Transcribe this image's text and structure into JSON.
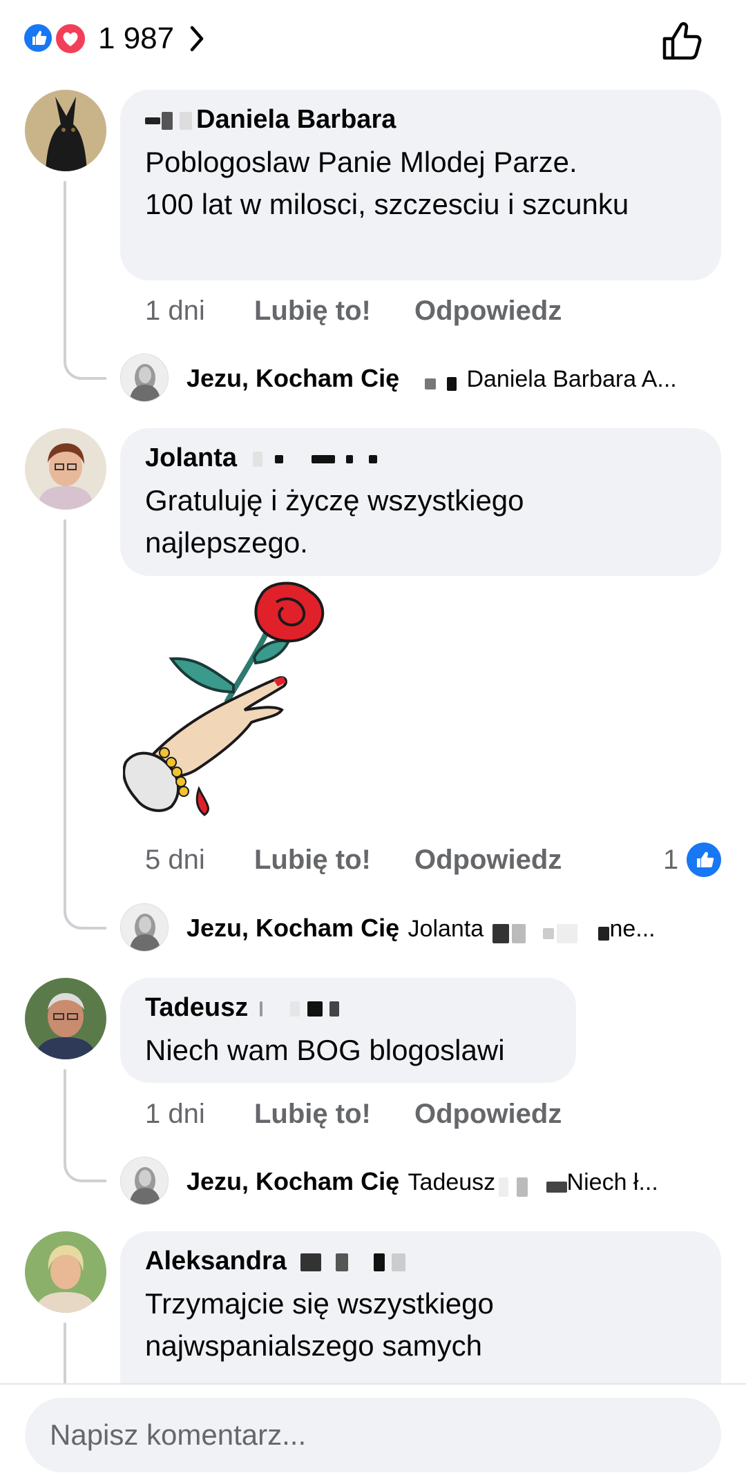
{
  "header": {
    "reaction_count": "1 987",
    "reactions": [
      "like-reaction-icon",
      "love-reaction-icon"
    ]
  },
  "comments": [
    {
      "author": "Daniela Barbara",
      "text": "Poblogoslaw Panie Mlodej Parze.\n100 lat w milosci, szczesciu i szcunku",
      "time": "1 dni",
      "like": "Lubię to!",
      "reply": "Odpowiedz",
      "reply_preview": {
        "author": "Jezu, Kocham Cię",
        "text": "Daniela Barbara A..."
      }
    },
    {
      "author": "Jolanta",
      "text": "Gratuluję i życzę wszystkiego najlepszego.",
      "time": "5 dni",
      "like": "Lubię to!",
      "reply": "Odpowiedz",
      "like_count": "1",
      "sticker": "rose-in-hand-sticker",
      "reply_preview": {
        "author": "Jezu, Kocham Cię",
        "text": "Jolanta",
        "suffix": "ne..."
      }
    },
    {
      "author": "Tadeusz",
      "text": "Niech wam BOG blogoslawi",
      "time": "1 dni",
      "like": "Lubię to!",
      "reply": "Odpowiedz",
      "reply_preview": {
        "author": "Jezu, Kocham Cię",
        "text": "Tadeusz",
        "suffix": "Niech ł..."
      }
    },
    {
      "author": "Aleksandra",
      "text": "Trzymajcie się wszystkiego najwspanialszego samych"
    }
  ],
  "composer": {
    "placeholder": "Napisz komentarz..."
  },
  "colors": {
    "accent": "#1877f2",
    "love": "#f33e58",
    "bubble": "#f0f2f5",
    "meta": "#65676b"
  }
}
